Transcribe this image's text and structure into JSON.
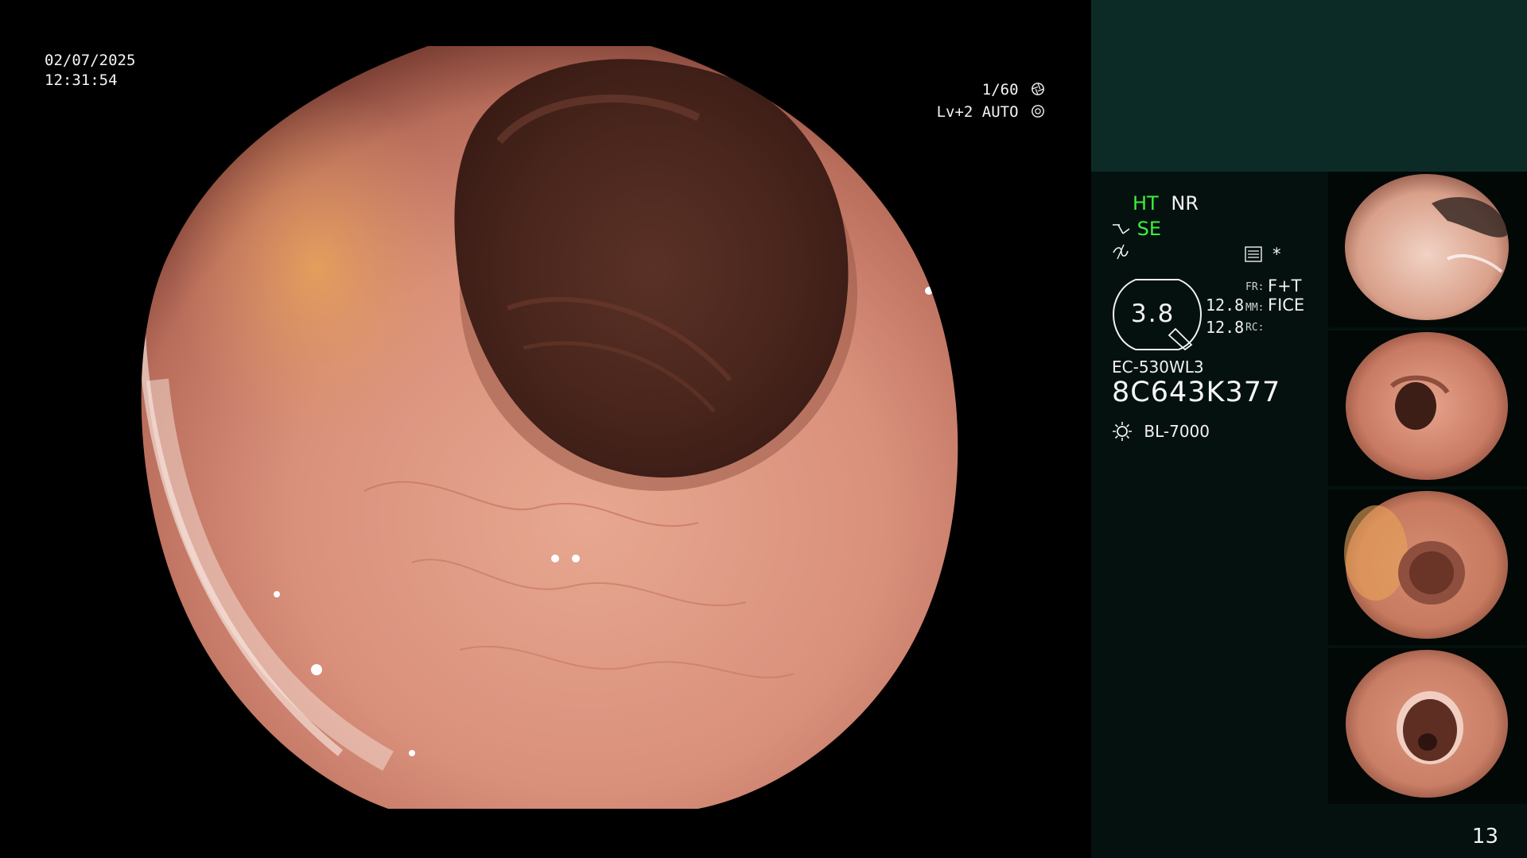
{
  "overlay": {
    "date": "02/07/2025",
    "time": "12:31:54",
    "shutter": "1/60",
    "iris": "Lv+2 AUTO"
  },
  "status": {
    "ht": "HT",
    "nr": "NR",
    "se": "SE",
    "enhance_icon": "structure-enhance-icon",
    "color_icon": "color-mode-icon",
    "menu_icon": "menu-list-icon",
    "star": "*"
  },
  "gauge": {
    "value": "3.8",
    "val_top": "12.8",
    "val_bottom": "12.8",
    "fr_label": "FR:",
    "fr_value": "F+T",
    "mm_label": "MM:",
    "mm_value": "FICE",
    "rc_label": "RC:"
  },
  "device": {
    "scope_model": "EC-530WL3",
    "scope_serial": "8C643K377",
    "light_source": "BL-7000",
    "light_icon": "lamp-icon"
  },
  "frame_count": "13",
  "colors": {
    "panel_bg": "#04110f",
    "panel_top": "#0d2b26",
    "accent_green": "#3df03d"
  }
}
